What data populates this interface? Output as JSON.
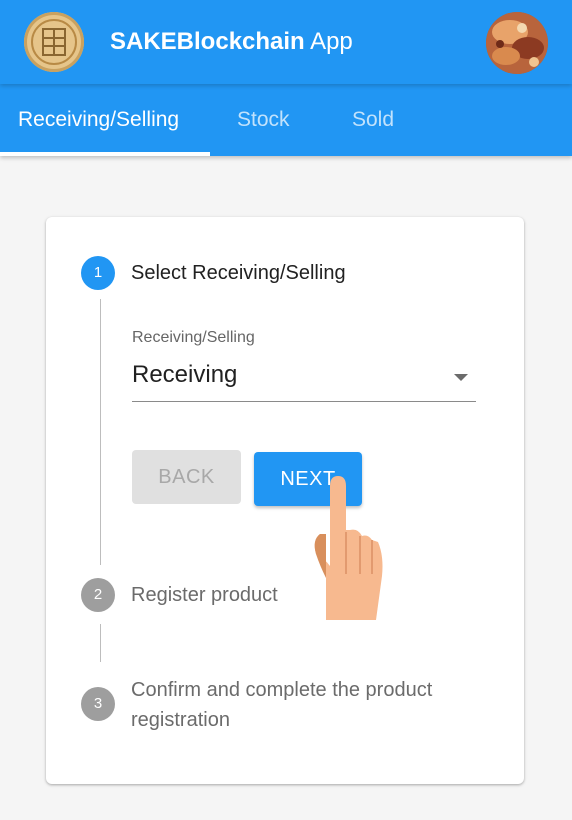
{
  "appbar": {
    "brand": "SAKEBlockchain",
    "suffix": " App"
  },
  "tabs": [
    {
      "label": "Receiving/Selling",
      "active": true
    },
    {
      "label": "Stock",
      "active": false
    },
    {
      "label": "Sold",
      "active": false
    }
  ],
  "stepper": {
    "steps": [
      {
        "number": "1",
        "label": "Select Receiving/Selling",
        "state": "active"
      },
      {
        "number": "2",
        "label": "Register product",
        "state": "inactive"
      },
      {
        "number": "3",
        "label_line1": "Confirm and complete the product",
        "label_line2": "registration",
        "state": "inactive"
      }
    ],
    "field": {
      "label": "Receiving/Selling",
      "value": "Receiving"
    },
    "back_label": "BACK",
    "next_label": "NEXT"
  },
  "colors": {
    "primary": "#2196f3",
    "inactive_step": "#9e9e9e",
    "hand": "#f7b98f"
  },
  "icons": {
    "logo": "sake-seal-logo",
    "avatar": "user-avatar",
    "dropdown": "chevron-down-icon",
    "pointer": "pointing-hand-icon"
  }
}
